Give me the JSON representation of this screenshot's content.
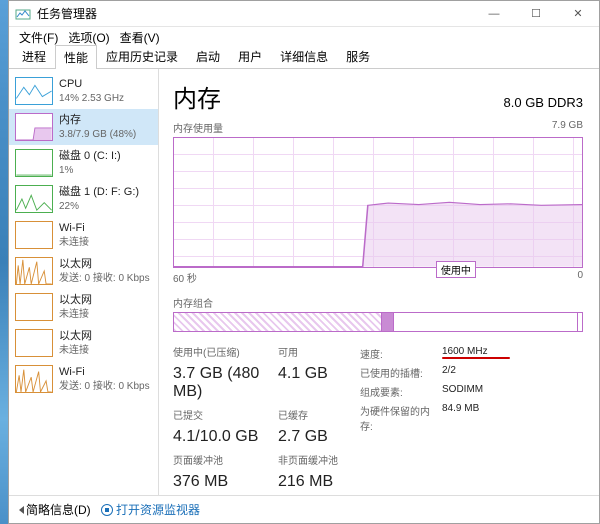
{
  "window": {
    "title": "任务管理器"
  },
  "menu": {
    "file": "文件(F)",
    "options": "选项(O)",
    "view": "查看(V)"
  },
  "tabs": [
    "进程",
    "性能",
    "应用历史记录",
    "启动",
    "用户",
    "详细信息",
    "服务"
  ],
  "active_tab": 1,
  "sidebar": {
    "items": [
      {
        "name": "CPU",
        "sub": "14% 2.53 GHz",
        "color": "#3aa0d8"
      },
      {
        "name": "内存",
        "sub": "3.8/7.9 GB (48%)",
        "color": "#bb6bc9",
        "selected": true
      },
      {
        "name": "磁盘 0 (C: I:)",
        "sub": "1%",
        "color": "#4caf50"
      },
      {
        "name": "磁盘 1 (D: F: G:)",
        "sub": "22%",
        "color": "#4caf50"
      },
      {
        "name": "Wi-Fi",
        "sub": "未连接",
        "color": "#d89038"
      },
      {
        "name": "以太网",
        "sub": "发送: 0 接收: 0 Kbps",
        "color": "#d89038"
      },
      {
        "name": "以太网",
        "sub": "未连接",
        "color": "#d89038"
      },
      {
        "name": "以太网",
        "sub": "未连接",
        "color": "#d89038"
      },
      {
        "name": "Wi-Fi",
        "sub": "发送: 0 接收: 0 Kbps",
        "color": "#d89038"
      }
    ]
  },
  "main": {
    "title": "内存",
    "capacity": "8.0 GB DDR3",
    "chart_top_left": "内存使用量",
    "chart_top_right": "7.9 GB",
    "chart_bottom_left": "60 秒",
    "chart_bottom_right": "0",
    "using_label": "使用中",
    "composition_label": "内存组合"
  },
  "chart_data": {
    "type": "area",
    "title": "内存使用量",
    "ylabel": "GB",
    "ylim": [
      0,
      7.9
    ],
    "x_seconds": [
      60,
      55,
      50,
      45,
      40,
      35,
      30,
      25,
      20,
      15,
      10,
      5,
      0
    ],
    "values_gb": [
      0,
      0,
      0,
      0,
      0,
      0,
      3.8,
      3.85,
      3.8,
      3.85,
      3.8,
      3.82,
      3.8
    ]
  },
  "stats_left": [
    {
      "label": "使用中(已压缩)",
      "value": "3.7 GB (480 MB)"
    },
    {
      "label": "可用",
      "value": "4.1 GB"
    },
    {
      "label": "已提交",
      "value": "4.1/10.0 GB"
    },
    {
      "label": "已缓存",
      "value": "2.7 GB"
    },
    {
      "label": "页面缓冲池",
      "value": "376 MB"
    },
    {
      "label": "非页面缓冲池",
      "value": "216 MB"
    }
  ],
  "stats_right": [
    {
      "label": "速度:",
      "value": "1600 MHz",
      "highlight": true
    },
    {
      "label": "已使用的插槽:",
      "value": "2/2"
    },
    {
      "label": "组成要素:",
      "value": "SODIMM"
    },
    {
      "label": "为硬件保留的内存:",
      "value": "84.9 MB"
    }
  ],
  "footer": {
    "brief": "简略信息(D)",
    "resmon": "打开资源监视器"
  }
}
